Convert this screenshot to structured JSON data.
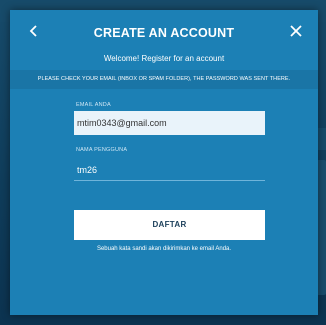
{
  "modal": {
    "title": "CREATE AN ACCOUNT",
    "subtitle": "Welcome! Register for an account",
    "notice": "PLEASE CHECK YOUR EMAIL (INBOX OR SPAM FOLDER), THE PASSWORD WAS SENT THERE.",
    "back_icon": "chevron-left-icon",
    "close_icon": "close-icon"
  },
  "form": {
    "email_label": "EMAIL ANDA",
    "email_value": "mtim0343@gmail.com",
    "username_label": "NAMA PENGGUNA",
    "username_value": "tm26",
    "submit_label": "DAFTAR",
    "info": "Sebuah kata sandi akan dikirimkan ke email Anda."
  },
  "colors": {
    "modal_bg": "#1c80b5",
    "notice_bg": "#1a75a6",
    "page_bg": "#0d3a57"
  }
}
